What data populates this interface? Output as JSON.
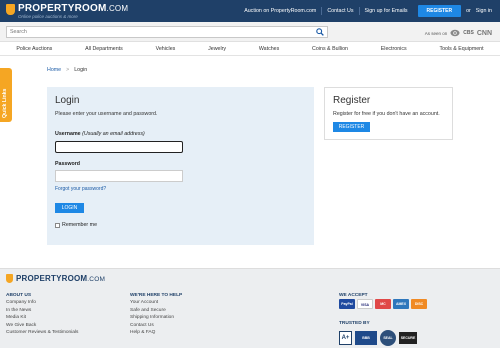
{
  "header": {
    "logo_text": "PROPERTYROOM",
    "logo_suffix": ".COM",
    "tagline": "Online police auctions & more",
    "links": [
      "Auction on PropertyRoom.com",
      "Contact Us",
      "Sign up for Emails"
    ],
    "register_label": "REGISTER",
    "or_text": "or",
    "signin_label": "Sign in"
  },
  "search": {
    "placeholder": "Search",
    "as_seen_on": "As seen on",
    "media": [
      "CBS",
      "CNN"
    ]
  },
  "nav": [
    "Police Auctions",
    "All Departments",
    "Vehicles",
    "Jewelry",
    "Watches",
    "Coins & Bullion",
    "Electronics",
    "Tools & Equipment"
  ],
  "quick_links": "Quick Links",
  "breadcrumb": {
    "home": "Home",
    "sep": ">",
    "current": "Login"
  },
  "login": {
    "title": "Login",
    "subtitle": "Please enter your username and password.",
    "username_label": "Username",
    "username_hint": "(Usually an email address)",
    "password_label": "Password",
    "forgot": "Forgot your password?",
    "button": "LOGIN",
    "remember": "Remember me"
  },
  "register": {
    "title": "Register",
    "subtitle": "Register for free if you don't have an account.",
    "button": "REGISTER"
  },
  "footer": {
    "logo_text": "PROPERTYROOM",
    "logo_suffix": ".COM",
    "about": {
      "heading": "ABOUT US",
      "items": [
        "Company Info",
        "In the News",
        "Media Kit",
        "We Give Back",
        "Customer Reviews & Testimonials"
      ]
    },
    "help": {
      "heading": "WE'RE HERE TO HELP",
      "items": [
        "Your Account",
        "Safe and Secure",
        "Shipping Information",
        "Contact Us",
        "Help & FAQ"
      ]
    },
    "accept": {
      "heading": "WE ACCEPT",
      "cards": [
        "PayPal",
        "VISA",
        "MC",
        "AMEX",
        "DISC"
      ]
    },
    "trusted": {
      "heading": "TRUSTED BY",
      "badges": [
        "A+",
        "BBB",
        "SEAL",
        "SECURE"
      ]
    }
  },
  "colors": {
    "navy": "#1f4068",
    "accent_blue": "#1e88e5",
    "orange": "#f5a623",
    "panel_bg": "#e6eff7"
  }
}
